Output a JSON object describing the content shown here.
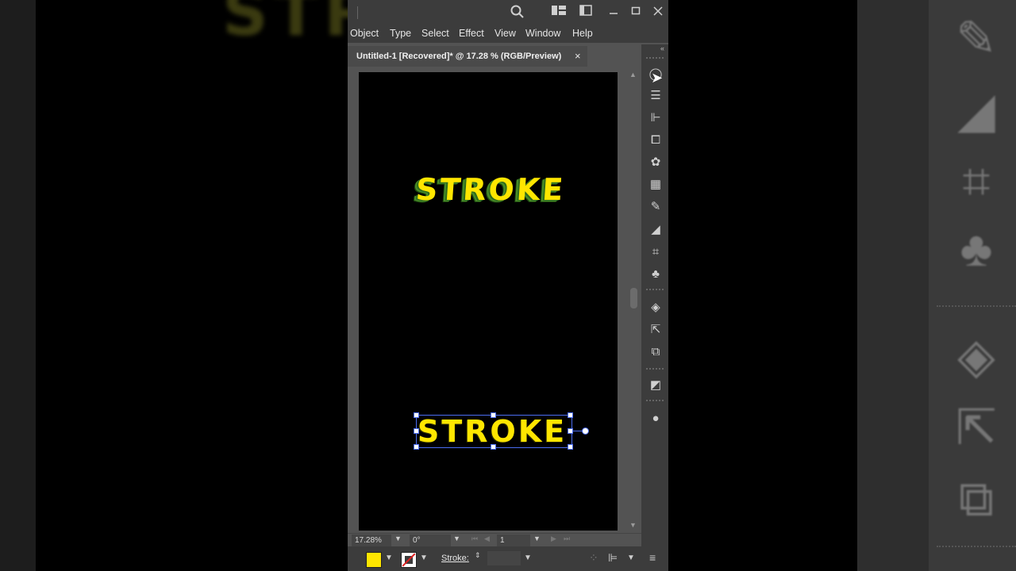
{
  "app": {
    "menu": [
      "Object",
      "Type",
      "Select",
      "Effect",
      "View",
      "Window",
      "Help"
    ],
    "document_tab": {
      "title": "Untitled-1 [Recovered]* @ 17.28 % (RGB/Preview)",
      "close": "×"
    }
  },
  "artboard": {
    "text_top": "STROKE",
    "text_bottom": "STROKE",
    "fill_color": "#ffe600",
    "shadow_color": "#2f6c1b"
  },
  "status": {
    "zoom": "17.28%",
    "rotation": "0°",
    "artboard_number": "1"
  },
  "control_bar": {
    "fill_color": "#ffe600",
    "stroke_label": "Stroke:",
    "stroke_value": ""
  },
  "icons": {
    "titlebar": [
      "search-icon",
      "workspace-icon",
      "arrange-icon",
      "minimize-icon",
      "maximize-icon",
      "close-icon"
    ],
    "panels": [
      "appearance-icon",
      "properties-icon",
      "align-icon",
      "artboards-icon",
      "color-guide-icon",
      "swatches-icon",
      "brushes-icon",
      "gradient-icon",
      "transform-icon",
      "symbols-icon",
      "layers-icon",
      "export-icon",
      "pathfinder-icon",
      "transparency-icon",
      "graphic-styles-icon"
    ]
  }
}
